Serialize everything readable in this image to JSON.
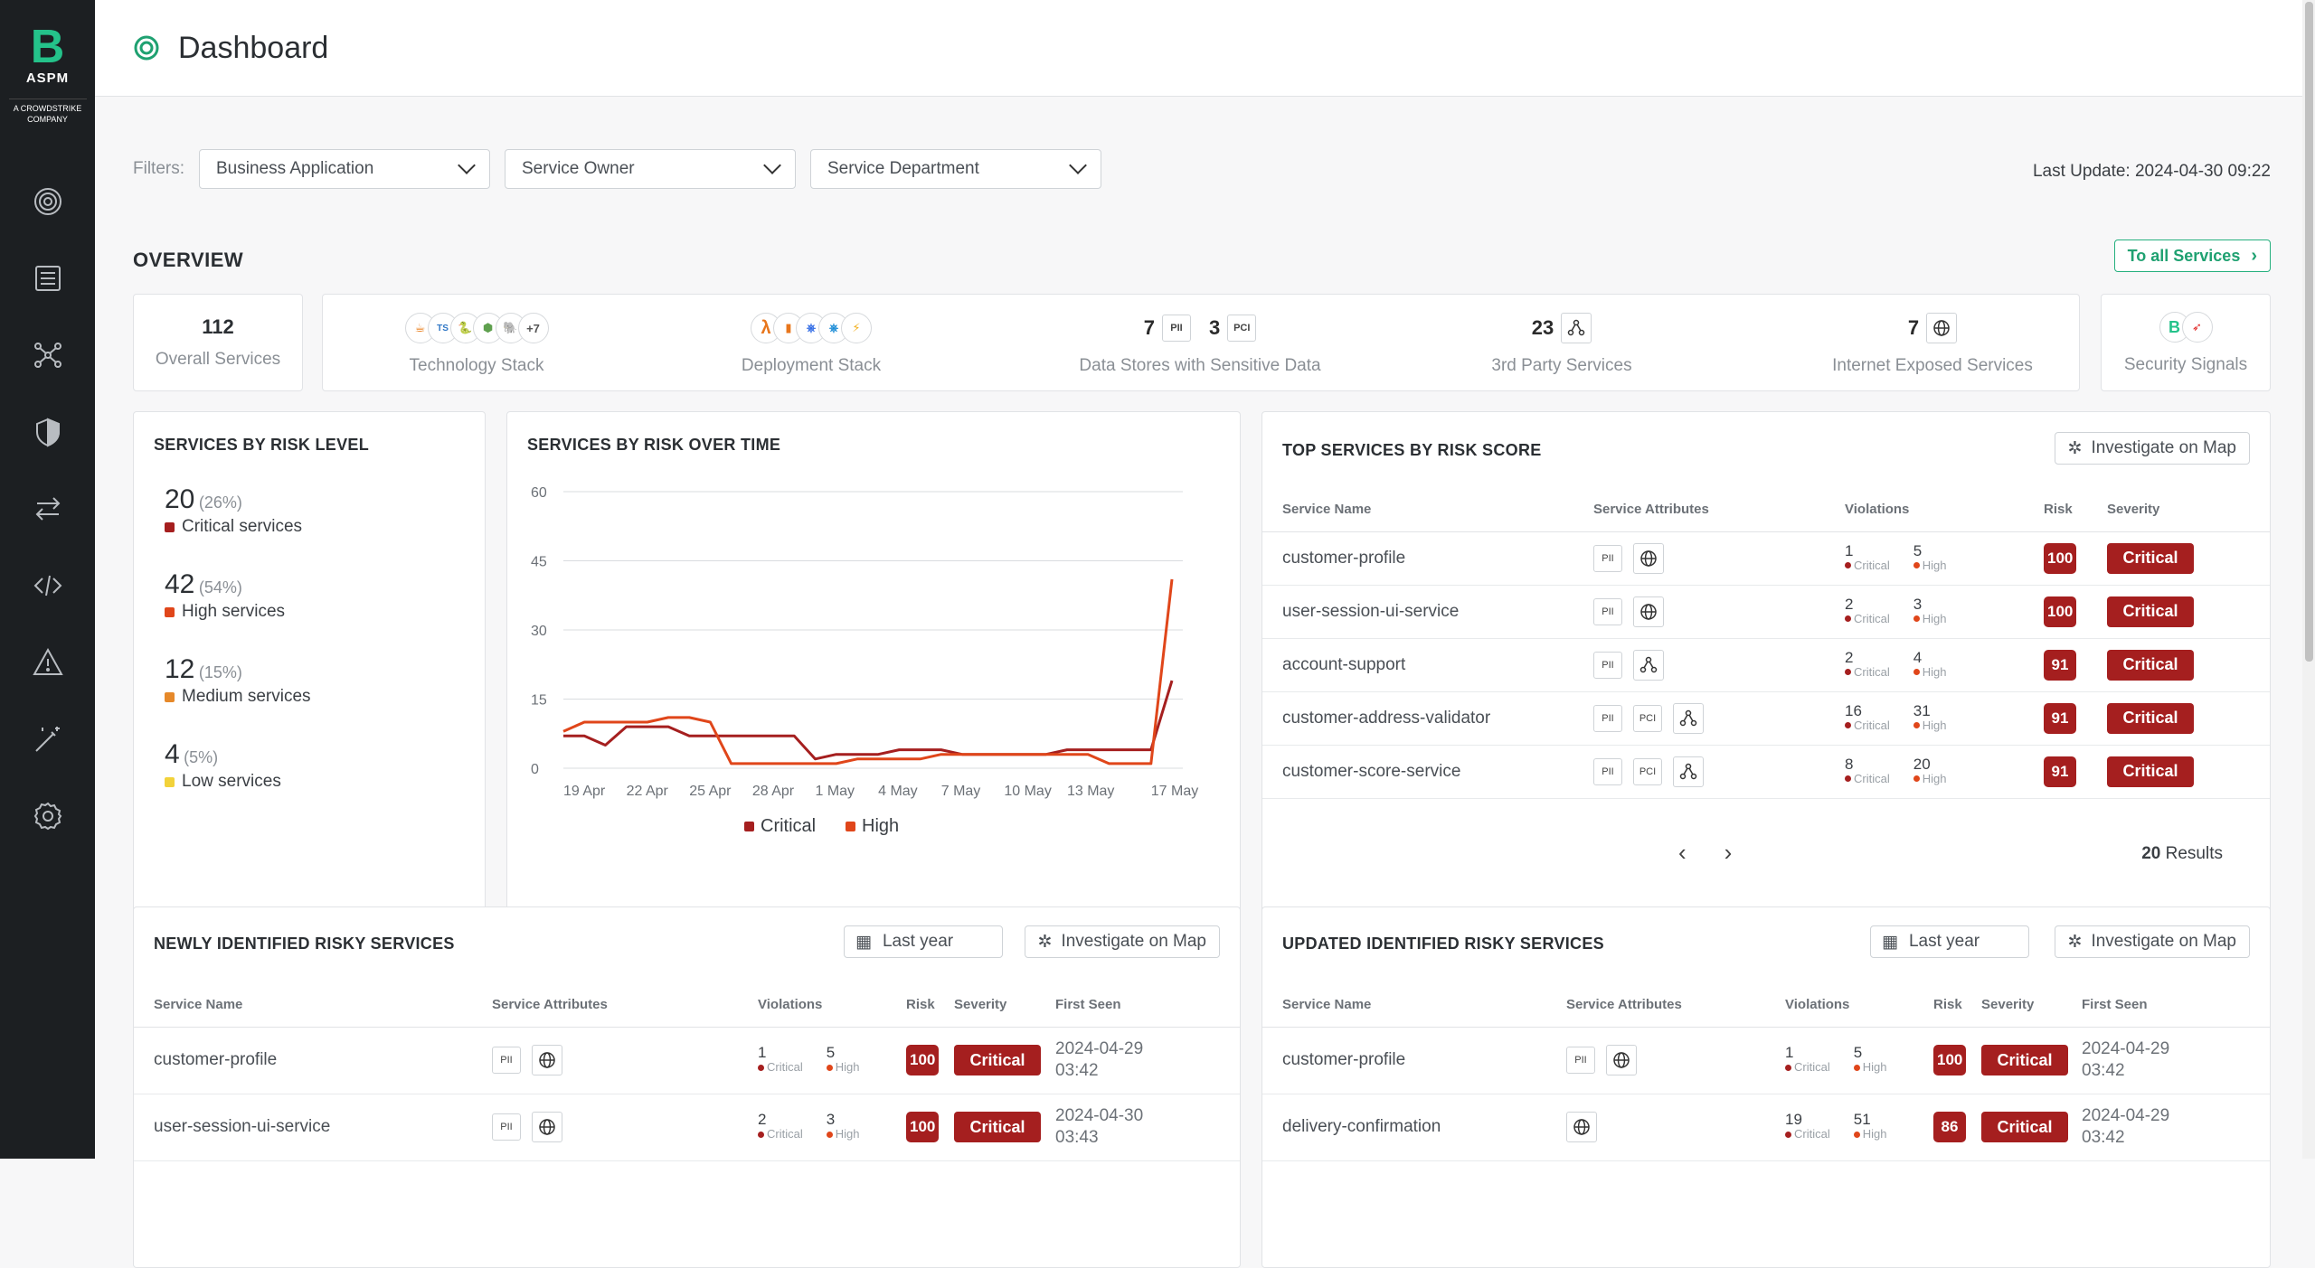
{
  "app": {
    "logo_letter": "B",
    "logo_name": "ASPM",
    "logo_company": "A CROWDSTRIKE COMPANY",
    "page_title": "Dashboard"
  },
  "sidebar": {
    "items": [
      {
        "icon": "dashboard-icon"
      },
      {
        "icon": "list-icon"
      },
      {
        "icon": "graph-icon"
      },
      {
        "icon": "shield-icon"
      },
      {
        "icon": "transfer-icon"
      },
      {
        "icon": "code-icon"
      },
      {
        "icon": "warning-icon"
      },
      {
        "icon": "wand-icon"
      },
      {
        "icon": "settings-icon"
      }
    ]
  },
  "filters": {
    "label": "Filters:",
    "dropdowns": [
      "Business Application",
      "Service Owner",
      "Service Department"
    ],
    "last_update": "Last Update: 2024-04-30 09:22"
  },
  "overview": {
    "title": "OVERVIEW",
    "to_all": "To all Services",
    "overall": {
      "value": "112",
      "label": "Overall Services"
    },
    "tech": {
      "label": "Technology Stack",
      "more": "+7"
    },
    "deploy": {
      "label": "Deployment Stack"
    },
    "datastores": {
      "pii_count": "7",
      "pii": "PII",
      "pci_count": "3",
      "pci": "PCI",
      "label": "Data Stores with Sensitive Data"
    },
    "third_party": {
      "value": "23",
      "label": "3rd Party Services"
    },
    "internet": {
      "value": "7",
      "label": "Internet Exposed Services"
    },
    "signals": {
      "label": "Security Signals"
    }
  },
  "risk_level": {
    "title": "SERVICES BY RISK LEVEL",
    "items": [
      {
        "count": "20",
        "pct": "(26%)",
        "label": "Critical services",
        "color": "#a51f1f"
      },
      {
        "count": "42",
        "pct": "(54%)",
        "label": "High services",
        "color": "#e0461a"
      },
      {
        "count": "12",
        "pct": "(15%)",
        "label": "Medium services",
        "color": "#e6892a"
      },
      {
        "count": "4",
        "pct": "(5%)",
        "label": "Low services",
        "color": "#f2d23a"
      }
    ]
  },
  "chart_data": {
    "type": "line",
    "title": "SERVICES BY RISK OVER TIME",
    "x": [
      "19 Apr",
      "20 Apr",
      "21 Apr",
      "22 Apr",
      "23 Apr",
      "24 Apr",
      "25 Apr",
      "26 Apr",
      "27 Apr",
      "28 Apr",
      "29 Apr",
      "30 Apr",
      "1 May",
      "2 May",
      "3 May",
      "4 May",
      "5 May",
      "6 May",
      "7 May",
      "8 May",
      "9 May",
      "10 May",
      "11 May",
      "12 May",
      "13 May",
      "14 May",
      "15 May",
      "16 May",
      "17 May",
      "18 May"
    ],
    "xticks": [
      "19 Apr",
      "22 Apr",
      "25 Apr",
      "28 Apr",
      "1 May",
      "4 May",
      "7 May",
      "10 May",
      "13 May",
      "17 May"
    ],
    "ylim": [
      0,
      60
    ],
    "yticks": [
      0,
      15,
      30,
      45,
      60
    ],
    "series": [
      {
        "name": "Critical",
        "color": "#a51f1f",
        "values": [
          7,
          7,
          5,
          9,
          9,
          9,
          7,
          7,
          7,
          7,
          7,
          7,
          2,
          3,
          3,
          3,
          4,
          4,
          4,
          3,
          3,
          3,
          3,
          3,
          4,
          4,
          4,
          4,
          4,
          19
        ]
      },
      {
        "name": "High",
        "color": "#e0461a",
        "values": [
          8,
          10,
          10,
          10,
          10,
          11,
          11,
          10,
          1,
          1,
          1,
          1,
          1,
          1,
          2,
          2,
          2,
          2,
          3,
          3,
          3,
          3,
          3,
          3,
          3,
          3,
          1,
          1,
          1,
          41
        ]
      }
    ]
  },
  "top_services": {
    "title": "TOP SERVICES BY RISK SCORE",
    "investigate": "Investigate on Map",
    "headers": [
      "Service Name",
      "Service Attributes",
      "Violations",
      "Risk",
      "Severity"
    ],
    "crit_label": "Critical",
    "high_label": "High",
    "rows": [
      {
        "name": "customer-profile",
        "pii": "PII",
        "pci": "",
        "extra": "globe",
        "crit": "1",
        "high": "5",
        "risk": "100",
        "sev": "Critical"
      },
      {
        "name": "user-session-ui-service",
        "pii": "PII",
        "pci": "",
        "extra": "globe",
        "crit": "2",
        "high": "3",
        "risk": "100",
        "sev": "Critical"
      },
      {
        "name": "account-support",
        "pii": "PII",
        "pci": "",
        "extra": "graph",
        "crit": "2",
        "high": "4",
        "risk": "91",
        "sev": "Critical"
      },
      {
        "name": "customer-address-validator",
        "pii": "PII",
        "pci": "PCI",
        "extra": "graph",
        "crit": "16",
        "high": "31",
        "risk": "91",
        "sev": "Critical"
      },
      {
        "name": "customer-score-service",
        "pii": "PII",
        "pci": "PCI",
        "extra": "graph",
        "crit": "8",
        "high": "20",
        "risk": "91",
        "sev": "Critical"
      }
    ],
    "results_count": "20",
    "results_label": "Results"
  },
  "newly": {
    "title": "NEWLY IDENTIFIED RISKY SERVICES",
    "date": "Last year",
    "investigate": "Investigate on Map",
    "headers": [
      "Service Name",
      "Service Attributes",
      "Violations",
      "Risk",
      "Severity",
      "First Seen"
    ],
    "rows": [
      {
        "name": "customer-profile",
        "pii": "PII",
        "extra": "globe",
        "crit": "1",
        "high": "5",
        "risk": "100",
        "sev": "Critical",
        "date": "2024-04-29",
        "time": "03:42"
      },
      {
        "name": "user-session-ui-service",
        "pii": "PII",
        "extra": "globe",
        "crit": "2",
        "high": "3",
        "risk": "100",
        "sev": "Critical",
        "date": "2024-04-30",
        "time": "03:43"
      }
    ]
  },
  "updated": {
    "title": "UPDATED IDENTIFIED RISKY SERVICES",
    "date": "Last year",
    "investigate": "Investigate on Map",
    "headers": [
      "Service Name",
      "Service Attributes",
      "Violations",
      "Risk",
      "Severity",
      "First Seen"
    ],
    "rows": [
      {
        "name": "customer-profile",
        "pii": "PII",
        "extra": "globe",
        "crit": "1",
        "high": "5",
        "risk": "100",
        "sev": "Critical",
        "date": "2024-04-29",
        "time": "03:42"
      },
      {
        "name": "delivery-confirmation",
        "pii": "",
        "extra": "globe",
        "crit": "19",
        "high": "51",
        "risk": "86",
        "sev": "Critical",
        "date": "2024-04-29",
        "time": "03:42"
      }
    ]
  }
}
